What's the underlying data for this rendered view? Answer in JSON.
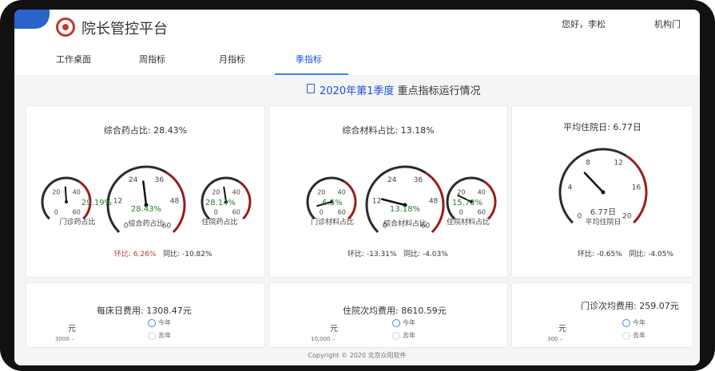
{
  "header": {
    "title": "院长管控平台",
    "user": "您好，李松",
    "org": "机构门"
  },
  "tabs": [
    {
      "label": "工作桌面"
    },
    {
      "label": "周指标"
    },
    {
      "label": "月指标"
    },
    {
      "label": "季指标"
    }
  ],
  "section": {
    "prefix": "2020年第1季度",
    "suffix": "重点指标运行情况"
  },
  "cards": {
    "drug": {
      "title": "综合药占比: 28.43%",
      "left_value": "29.19%",
      "center_value": "28.43%",
      "right_value": "28.14%",
      "left_label": "门诊药占比",
      "center_label": "综合药占比",
      "right_label": "住院药占比",
      "ratio_left": "环比: 6.26%",
      "ratio_right": "同比: -10.82%"
    },
    "material": {
      "title": "综合材料占比: 13.18%",
      "left_value": "6.5%",
      "center_value": "13.18%",
      "right_value": "15.73%",
      "left_label": "门诊材料占比",
      "center_label": "综合材料占比",
      "right_label": "住院材料占比",
      "ratio_left": "环比: -13.31%",
      "ratio_right": "同比: -4.03%"
    },
    "stay": {
      "title": "平均住院日: 6.77日",
      "value": "6.77日",
      "label": "平均住院日",
      "ratio_left": "环比: -0.65%",
      "ratio_right": "同比: -4.05%"
    }
  },
  "bottom": {
    "cost1": {
      "title": "每床日费用: 1308.47元",
      "unit": "元",
      "legend_now": "今年",
      "legend_last": "去年",
      "axis": "3000 –"
    },
    "cost2": {
      "title": "住院次均费用: 8610.59元",
      "unit": "元",
      "legend_now": "今年",
      "legend_last": "去年",
      "axis": "10,000 –"
    },
    "cost3": {
      "title": "门诊次均费用: 259.07元",
      "unit": "元",
      "legend_now": "今年",
      "legend_last": "去年",
      "axis": "300 –"
    }
  },
  "footer": "Copyright © 2020 北京众阳软件",
  "gauges": {
    "g1": {
      "ticks": [
        "0",
        "20",
        "40",
        "60"
      ],
      "value": 29.19,
      "min": 0,
      "max": 60
    },
    "g2": {
      "ticks": [
        "0",
        "12",
        "24",
        "36",
        "48",
        "60"
      ],
      "value": 28.43,
      "min": 0,
      "max": 60
    },
    "g3": {
      "ticks": [
        "0",
        "20",
        "40",
        "60"
      ],
      "value": 28.14,
      "min": 0,
      "max": 60
    },
    "g4": {
      "ticks": [
        "0",
        "20",
        "40",
        "60"
      ],
      "value": 6.5,
      "min": 0,
      "max": 60
    },
    "g5": {
      "ticks": [
        "0",
        "12",
        "24",
        "36",
        "48",
        "60"
      ],
      "value": 13.18,
      "min": 0,
      "max": 60
    },
    "g6": {
      "ticks": [
        "0",
        "20",
        "40",
        "60"
      ],
      "value": 15.73,
      "min": 0,
      "max": 60
    },
    "g7": {
      "ticks": [
        "0",
        "4",
        "8",
        "12",
        "16",
        "20"
      ],
      "value": 6.77,
      "min": 0,
      "max": 20
    }
  },
  "colors": {
    "accent": "#1d4ed8",
    "danger": "#c0392b",
    "ok": "#2e7d32"
  }
}
